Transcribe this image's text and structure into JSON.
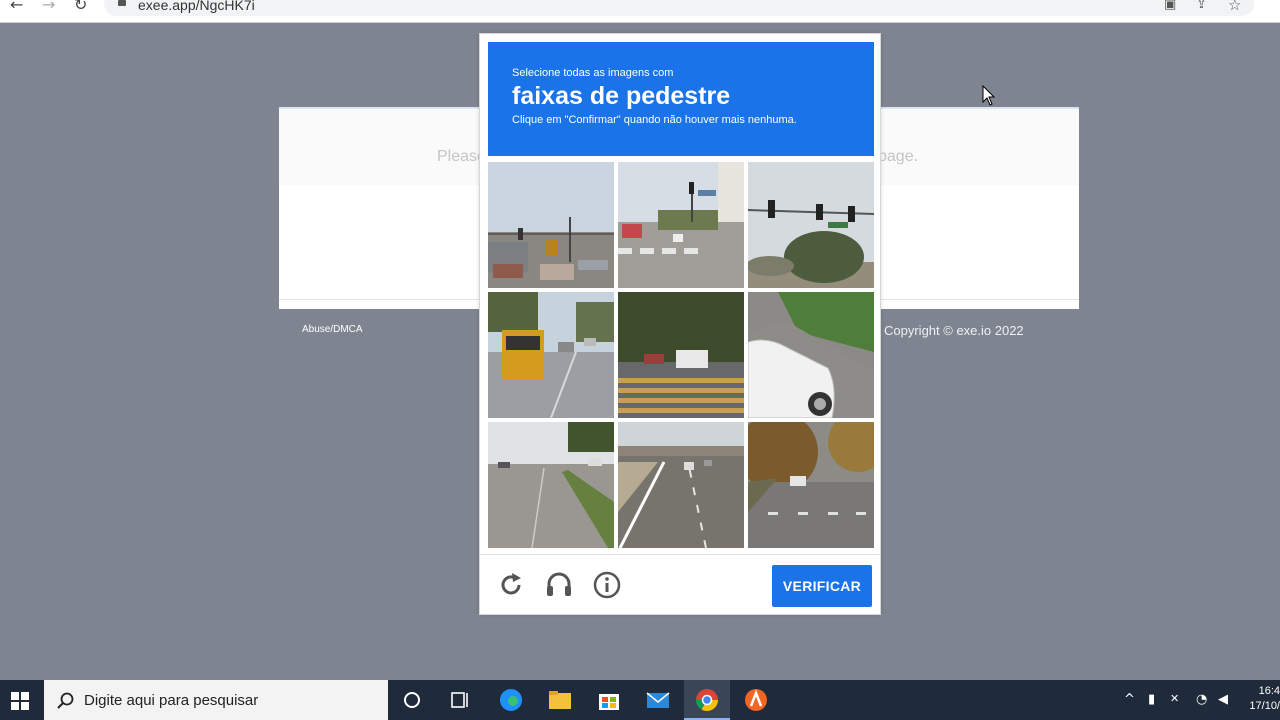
{
  "browser": {
    "url": "exee.app/NgcHK7i",
    "back": "←",
    "forward": "→",
    "reload": "↻",
    "star": "☆"
  },
  "page": {
    "message_left": "Please",
    "message_right": "page.",
    "abuse_link": "Abuse/DMCA",
    "copyright": "Copyright © exe.io 2022"
  },
  "captcha": {
    "instruction_line1": "Selecione todas as imagens com",
    "target": "faixas de pedestre",
    "instruction_line2": "Clique em \"Confirmar\" quando não houver mais nenhuma.",
    "tiles": [
      {
        "index": 1,
        "icon": "street-intersection-image"
      },
      {
        "index": 2,
        "icon": "crosswalk-street-image"
      },
      {
        "index": 3,
        "icon": "traffic-light-trees-image"
      },
      {
        "index": 4,
        "icon": "school-bus-road-image"
      },
      {
        "index": 5,
        "icon": "crosswalk-trees-image"
      },
      {
        "index": 6,
        "icon": "white-car-image"
      },
      {
        "index": 7,
        "icon": "road-curb-image"
      },
      {
        "index": 8,
        "icon": "highway-overpass-image"
      },
      {
        "index": 9,
        "icon": "autumn-street-image"
      }
    ],
    "verify_label": "VERIFICAR",
    "colors": {
      "accent": "#1a73e8"
    }
  },
  "taskbar": {
    "search_placeholder": "Digite aqui para pesquisar",
    "clock_time": "16:4",
    "clock_date": "17/10/",
    "apps": [
      "cortana-icon",
      "task-view-icon",
      "edge-icon",
      "file-explorer-icon",
      "store-icon",
      "mail-icon",
      "chrome-icon",
      "avast-icon"
    ]
  }
}
